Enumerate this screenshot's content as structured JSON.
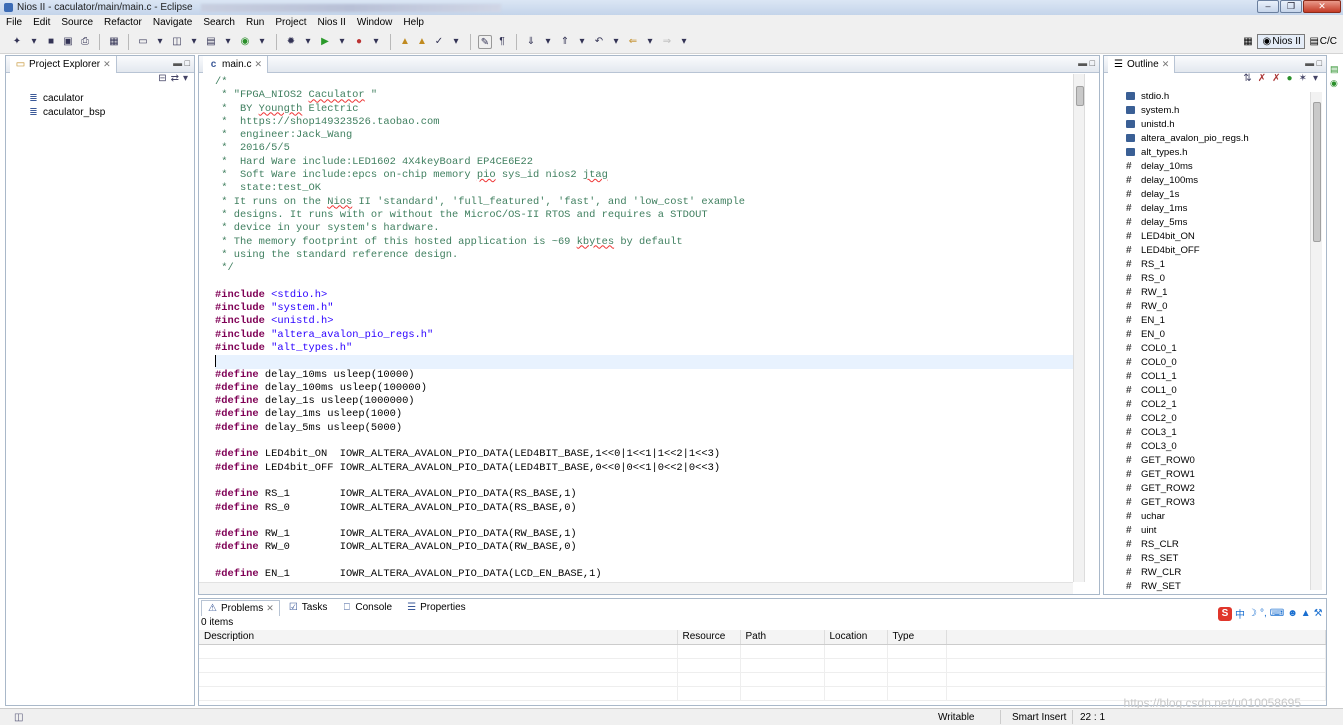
{
  "window": {
    "title": "Nios II - caculator/main/main.c - Eclipse",
    "title_blur": "[obscured]"
  },
  "menu": [
    "File",
    "Edit",
    "Source",
    "Refactor",
    "Navigate",
    "Search",
    "Run",
    "Project",
    "Nios II",
    "Window",
    "Help"
  ],
  "perspectives": {
    "active": "Nios II",
    "other": "C/C"
  },
  "project_explorer": {
    "tab": "Project Explorer",
    "items": [
      "caculator",
      "caculator_bsp"
    ]
  },
  "editor": {
    "tab": "main.c",
    "lines": [
      [
        [
          "cm",
          "/*"
        ]
      ],
      [
        [
          "cm",
          " * \"FPGA_NIOS2 "
        ],
        [
          "cms",
          "Caculator"
        ],
        [
          "cm",
          " \""
        ]
      ],
      [
        [
          "cm",
          " *  BY "
        ],
        [
          "cms",
          "Youngth"
        ],
        [
          "cm",
          " Electric"
        ]
      ],
      [
        [
          "cm",
          " *  https://shop149323526.taobao.com"
        ]
      ],
      [
        [
          "cm",
          " *  engineer:Jack_Wang"
        ]
      ],
      [
        [
          "cm",
          " *  2016/5/5"
        ]
      ],
      [
        [
          "cm",
          " *  Hard Ware include:LED1602 4X4keyBoard EP4CE6E22"
        ]
      ],
      [
        [
          "cm",
          " *  Soft Ware include:epcs on-chip memory "
        ],
        [
          "cms",
          "pio"
        ],
        [
          "cm",
          " sys_id nios2 "
        ],
        [
          "cms",
          "jtag"
        ]
      ],
      [
        [
          "cm",
          " *  state:test_OK"
        ]
      ],
      [
        [
          "cm",
          " * It runs on the "
        ],
        [
          "cms",
          "Nios"
        ],
        [
          "cm",
          " II 'standard', 'full_featured', 'fast', and 'low_cost' example"
        ]
      ],
      [
        [
          "cm",
          " * designs. It runs with or without the MicroC/OS-II RTOS and requires a STDOUT"
        ]
      ],
      [
        [
          "cm",
          " * device in your system's hardware."
        ]
      ],
      [
        [
          "cm",
          " * The memory footprint of this hosted application is ~69 "
        ],
        [
          "cms",
          "kbytes"
        ],
        [
          "cm",
          " by default"
        ]
      ],
      [
        [
          "cm",
          " * using the standard reference design."
        ]
      ],
      [
        [
          "cm",
          " */"
        ]
      ],
      [],
      [
        [
          "kw",
          "#include"
        ],
        [
          "t",
          " "
        ],
        [
          "st",
          "<stdio.h>"
        ]
      ],
      [
        [
          "kw",
          "#include"
        ],
        [
          "t",
          " "
        ],
        [
          "st",
          "\"system.h\""
        ]
      ],
      [
        [
          "kw",
          "#include"
        ],
        [
          "t",
          " "
        ],
        [
          "st",
          "<unistd.h>"
        ]
      ],
      [
        [
          "kw",
          "#include"
        ],
        [
          "t",
          " "
        ],
        [
          "st",
          "\"altera_avalon_pio_regs.h\""
        ]
      ],
      [
        [
          "kw",
          "#include"
        ],
        [
          "t",
          " "
        ],
        [
          "st",
          "\"alt_types.h\""
        ]
      ],
      [],
      [
        [
          "kw",
          "#define"
        ],
        [
          "t",
          " delay_10ms usleep(10000)"
        ]
      ],
      [
        [
          "kw",
          "#define"
        ],
        [
          "t",
          " delay_100ms usleep(100000)"
        ]
      ],
      [
        [
          "kw",
          "#define"
        ],
        [
          "t",
          " delay_1s usleep(1000000)"
        ]
      ],
      [
        [
          "kw",
          "#define"
        ],
        [
          "t",
          " delay_1ms usleep(1000)"
        ]
      ],
      [
        [
          "kw",
          "#define"
        ],
        [
          "t",
          " delay_5ms usleep(5000)"
        ]
      ],
      [],
      [
        [
          "kw",
          "#define"
        ],
        [
          "t",
          " LED4bit_ON  IOWR_ALTERA_AVALON_PIO_DATA(LED4BIT_BASE,1<<0|1<<1|1<<2|1<<3)"
        ]
      ],
      [
        [
          "kw",
          "#define"
        ],
        [
          "t",
          " LED4bit_OFF IOWR_ALTERA_AVALON_PIO_DATA(LED4BIT_BASE,0<<0|0<<1|0<<2|0<<3)"
        ]
      ],
      [],
      [
        [
          "kw",
          "#define"
        ],
        [
          "t",
          " RS_1        IOWR_ALTERA_AVALON_PIO_DATA(RS_BASE,1)"
        ]
      ],
      [
        [
          "kw",
          "#define"
        ],
        [
          "t",
          " RS_0        IOWR_ALTERA_AVALON_PIO_DATA(RS_BASE,0)"
        ]
      ],
      [],
      [
        [
          "kw",
          "#define"
        ],
        [
          "t",
          " RW_1        IOWR_ALTERA_AVALON_PIO_DATA(RW_BASE,1)"
        ]
      ],
      [
        [
          "kw",
          "#define"
        ],
        [
          "t",
          " RW_0        IOWR_ALTERA_AVALON_PIO_DATA(RW_BASE,0)"
        ]
      ],
      [],
      [
        [
          "kw",
          "#define"
        ],
        [
          "t",
          " EN_1        IOWR_ALTERA_AVALON_PIO_DATA(LCD_EN_BASE,1)"
        ]
      ],
      [
        [
          "kw",
          "#define"
        ],
        [
          "t",
          " EN_0        IOWR_ALTERA_AVALON_PIO_DATA(LCD_EN_BASE,0)"
        ]
      ]
    ]
  },
  "outline": {
    "tab": "Outline",
    "items": [
      {
        "k": "h",
        "t": "stdio.h"
      },
      {
        "k": "h",
        "t": "system.h"
      },
      {
        "k": "h",
        "t": "unistd.h"
      },
      {
        "k": "h",
        "t": "altera_avalon_pio_regs.h"
      },
      {
        "k": "h",
        "t": "alt_types.h"
      },
      {
        "k": "d",
        "t": "delay_10ms"
      },
      {
        "k": "d",
        "t": "delay_100ms"
      },
      {
        "k": "d",
        "t": "delay_1s"
      },
      {
        "k": "d",
        "t": "delay_1ms"
      },
      {
        "k": "d",
        "t": "delay_5ms"
      },
      {
        "k": "d",
        "t": "LED4bit_ON"
      },
      {
        "k": "d",
        "t": "LED4bit_OFF"
      },
      {
        "k": "d",
        "t": "RS_1"
      },
      {
        "k": "d",
        "t": "RS_0"
      },
      {
        "k": "d",
        "t": "RW_1"
      },
      {
        "k": "d",
        "t": "RW_0"
      },
      {
        "k": "d",
        "t": "EN_1"
      },
      {
        "k": "d",
        "t": "EN_0"
      },
      {
        "k": "d",
        "t": "COL0_1"
      },
      {
        "k": "d",
        "t": "COL0_0"
      },
      {
        "k": "d",
        "t": "COL1_1"
      },
      {
        "k": "d",
        "t": "COL1_0"
      },
      {
        "k": "d",
        "t": "COL2_1"
      },
      {
        "k": "d",
        "t": "COL2_0"
      },
      {
        "k": "d",
        "t": "COL3_1"
      },
      {
        "k": "d",
        "t": "COL3_0"
      },
      {
        "k": "d",
        "t": "GET_ROW0"
      },
      {
        "k": "d",
        "t": "GET_ROW1"
      },
      {
        "k": "d",
        "t": "GET_ROW2"
      },
      {
        "k": "d",
        "t": "GET_ROW3"
      },
      {
        "k": "d",
        "t": "uchar"
      },
      {
        "k": "d",
        "t": "uint"
      },
      {
        "k": "d",
        "t": "RS_CLR"
      },
      {
        "k": "d",
        "t": "RS_SET"
      },
      {
        "k": "d",
        "t": "RW_CLR"
      },
      {
        "k": "d",
        "t": "RW_SET"
      }
    ]
  },
  "bottom": {
    "tabs": [
      "Problems",
      "Tasks",
      "Console",
      "Properties"
    ],
    "count": "0 items",
    "columns": [
      "Description",
      "Resource",
      "Path",
      "Location",
      "Type"
    ]
  },
  "status": {
    "writable": "Writable",
    "mode": "Smart Insert",
    "pos": "22 : 1"
  },
  "watermark": "https://blog.csdn.net/u010058695"
}
